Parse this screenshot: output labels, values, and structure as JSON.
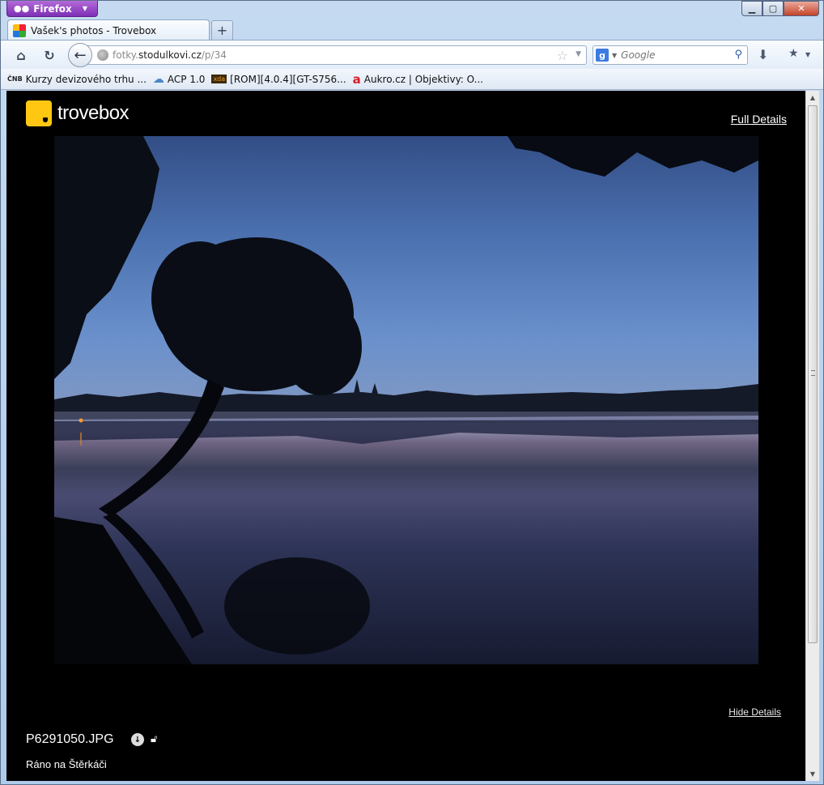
{
  "browser": {
    "menu_button": "Firefox",
    "tab_title": "Vašek's photos - Trovebox",
    "url_host_prefix": "fotky.",
    "url_host": "stodulkovi.cz",
    "url_path": "/p/34",
    "search_placeholder": "Google",
    "bookmarks": [
      {
        "label": "Kurzy devizového trhu ...",
        "icon": "cnb-icon"
      },
      {
        "label": "ACP 1.0",
        "icon": "cloud-icon"
      },
      {
        "label": "[ROM][4.0.4][GT-S756...",
        "icon": "xda-icon"
      },
      {
        "label": "Aukro.cz | Objektivy: O...",
        "icon": "aukro-icon"
      }
    ]
  },
  "page": {
    "logo_text": "trovebox",
    "full_details": "Full Details",
    "hide_details": "Hide Details",
    "filename": "P6291050.JPG",
    "caption": "Ráno na Štěrkáči",
    "photo_alt": "Lake at dawn with tree silhouette"
  },
  "colors": {
    "firefox_button": "#9a45c8",
    "logo_yellow": "#ffc712",
    "page_background": "#000000"
  }
}
